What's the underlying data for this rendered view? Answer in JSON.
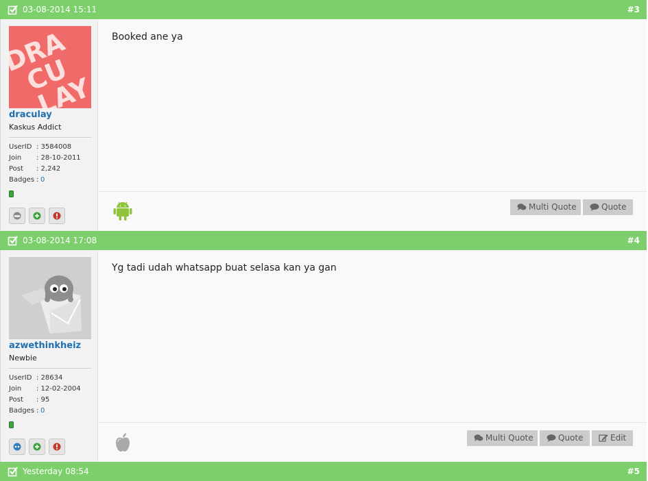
{
  "posts": [
    {
      "date": "03-08-2014 15:11",
      "number": "#3",
      "user": {
        "avatar_text": "DRACULAY",
        "username": "draculay",
        "title": "Kaskus Addict",
        "stats": [
          {
            "label": "UserID",
            "value": ": 3584008"
          },
          {
            "label": "Join",
            "value": ": 28-10-2011"
          },
          {
            "label": "Post",
            "value": ": 2,242"
          },
          {
            "label": "Badges",
            "value": "0"
          }
        ]
      },
      "message": "Booked ane ya",
      "device": "android-icon",
      "buttons": {
        "multi_quote": "Multi Quote",
        "quote": "Quote"
      }
    },
    {
      "date": "03-08-2014 17:08",
      "number": "#4",
      "user": {
        "username": "azwethinkheiz",
        "title": "Newbie",
        "stats": [
          {
            "label": "UserID",
            "value": ": 28634"
          },
          {
            "label": "Join",
            "value": ": 12-02-2004"
          },
          {
            "label": "Post",
            "value": ": 95"
          },
          {
            "label": "Badges",
            "value": "0"
          }
        ]
      },
      "message": "Yg tadi udah whatsapp buat selasa kan ya gan",
      "device": "apple-icon",
      "buttons": {
        "multi_quote": "Multi Quote",
        "quote": "Quote",
        "edit": "Edit"
      }
    },
    {
      "date": "Yesterday 08:54",
      "number": "#5"
    }
  ],
  "colors": {
    "header_green": "#7ccf6b",
    "link_blue": "#1f6fb0",
    "avatar_red": "#f06a6a",
    "button_gray": "#cccccc"
  }
}
